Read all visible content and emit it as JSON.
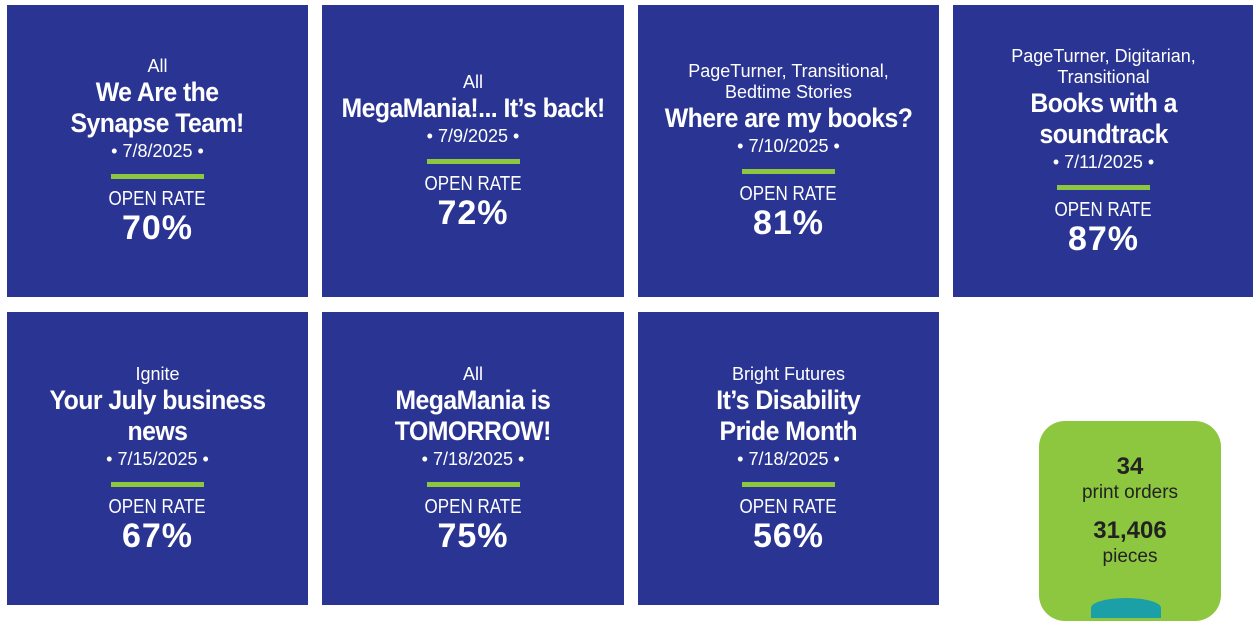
{
  "tiles": [
    {
      "audience": "All",
      "title": [
        "We Are the",
        "Synapse Team!"
      ],
      "date": "• 7/8/2025 •",
      "open_rate_label": "OPEN RATE",
      "open_rate": "70%"
    },
    {
      "audience": "All",
      "title": [
        "MegaMania!... It’s back!"
      ],
      "date": "• 7/9/2025 •",
      "open_rate_label": "OPEN RATE",
      "open_rate": "72%"
    },
    {
      "audience": "PageTurner, Transitional, Bedtime Stories",
      "title": [
        "Where are my books?"
      ],
      "date": "• 7/10/2025 •",
      "open_rate_label": "OPEN RATE",
      "open_rate": "81%"
    },
    {
      "audience": "PageTurner, Digitarian, Transitional",
      "title": [
        "Books with a",
        "soundtrack"
      ],
      "date": "• 7/11/2025 •",
      "open_rate_label": "OPEN RATE",
      "open_rate": "87%"
    },
    {
      "audience": "Ignite",
      "title": [
        "Your July business news"
      ],
      "date": "• 7/15/2025 •",
      "open_rate_label": "OPEN RATE",
      "open_rate": "67%"
    },
    {
      "audience": "All",
      "title": [
        "MegaMania is",
        "TOMORROW!"
      ],
      "date": "• 7/18/2025 •",
      "open_rate_label": "OPEN RATE",
      "open_rate": "75%"
    },
    {
      "audience": "Bright Futures",
      "title": [
        "It’s Disability",
        "Pride Month"
      ],
      "date": "• 7/18/2025 •",
      "open_rate_label": "OPEN RATE",
      "open_rate": "56%"
    }
  ],
  "print_stats": {
    "orders_value": "34",
    "orders_label": "print orders",
    "pieces_value": "31,406",
    "pieces_label": "pieces"
  },
  "colors": {
    "tile_bg": "#2a3593",
    "accent_bar": "#8dc63f",
    "stats_bg": "#8dc63f",
    "teal": "#1aa0a6"
  }
}
